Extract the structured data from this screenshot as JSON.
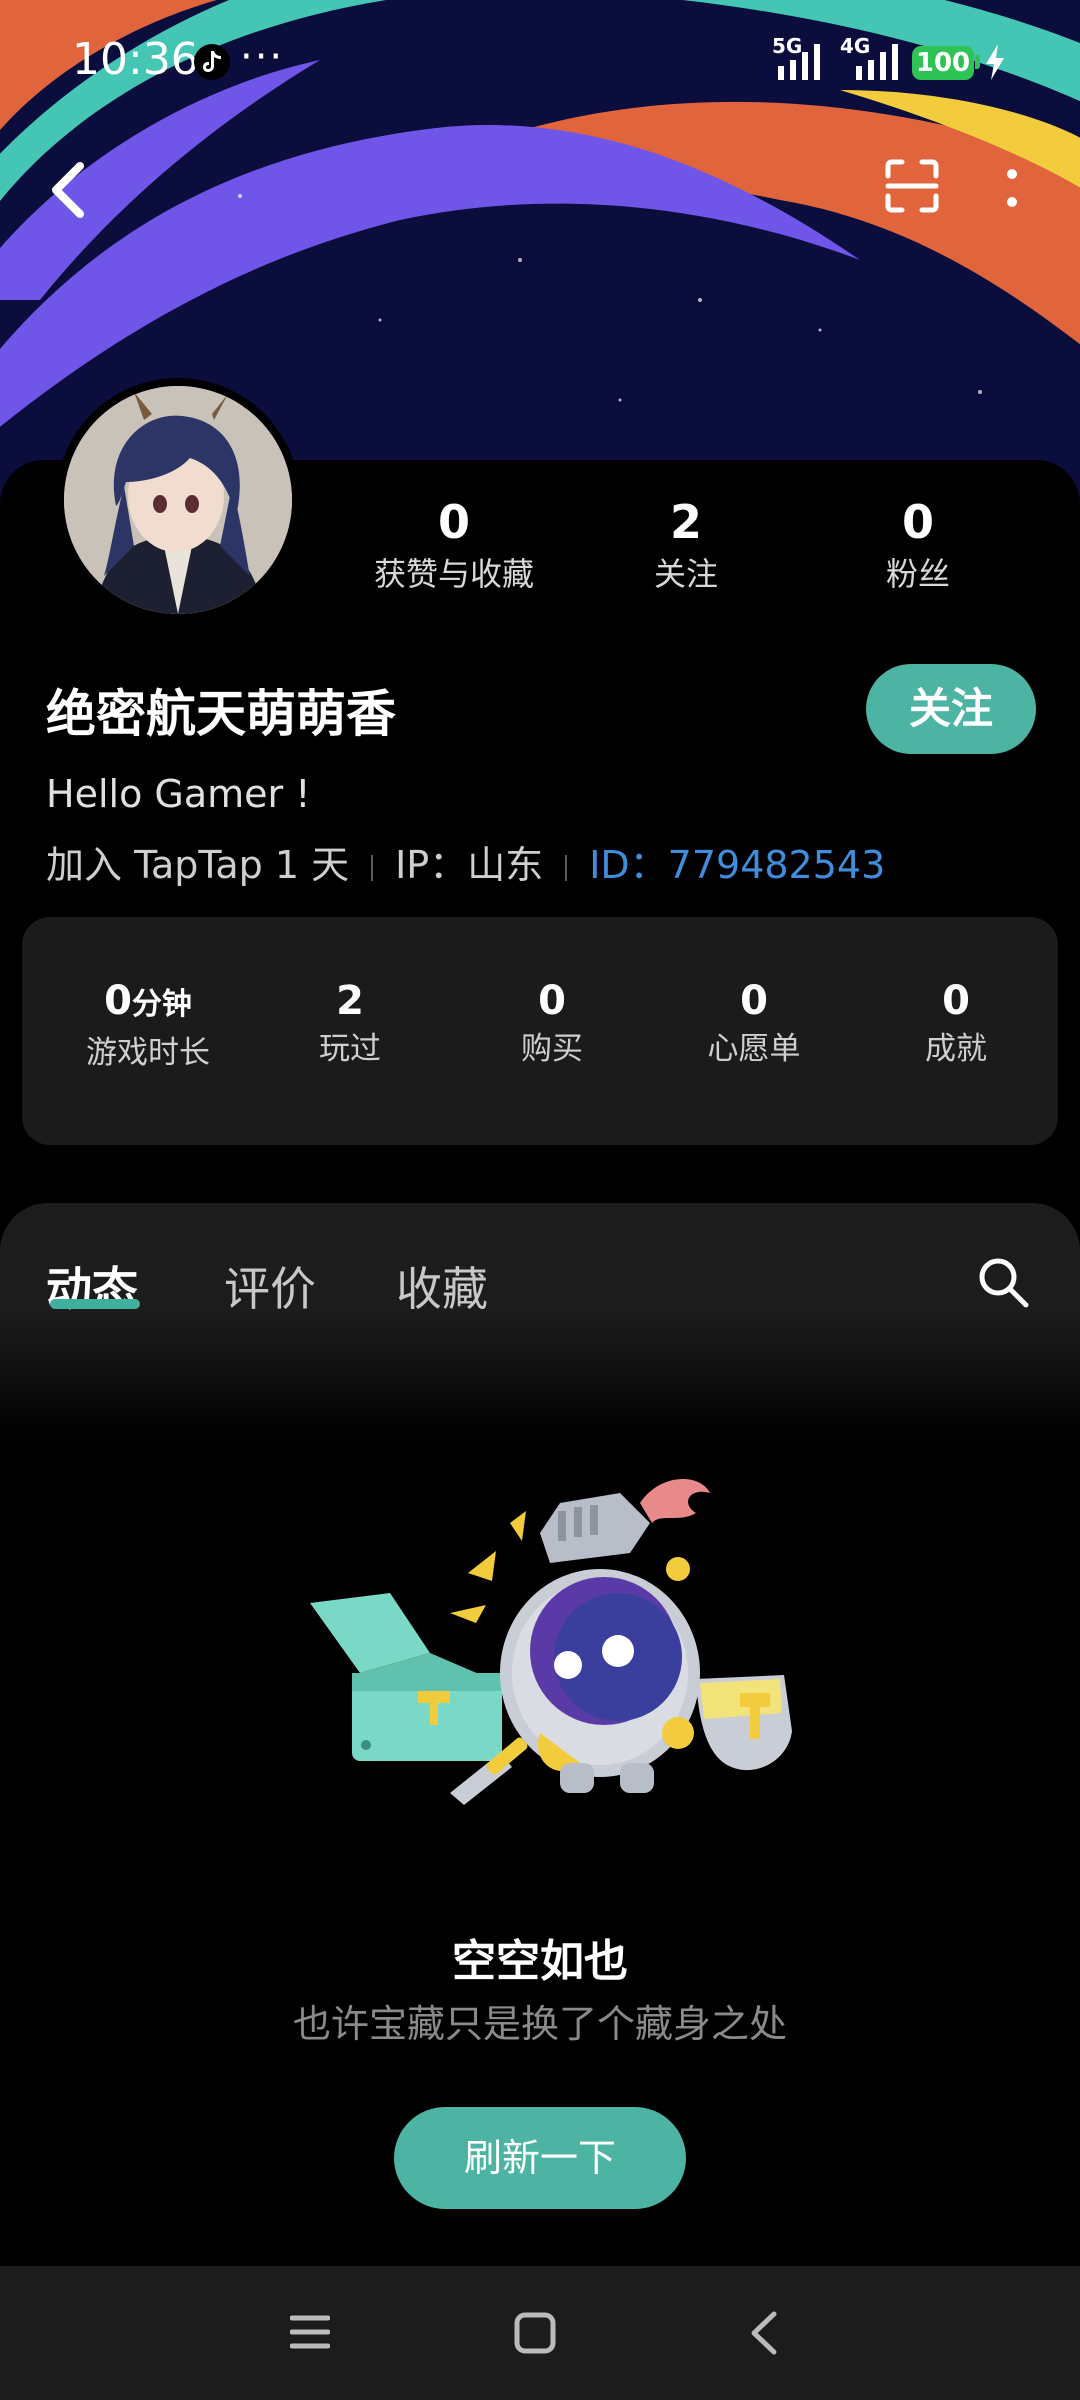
{
  "status_bar": {
    "time": "10:36",
    "more": "···",
    "net_5g": "5G",
    "net_4g": "4G",
    "battery": "100"
  },
  "profile": {
    "username": "绝密航天萌萌香",
    "follow_label": "关注",
    "bio": "Hello Gamer !",
    "joined": "加入 TapTap 1 天",
    "ip": "IP：山东",
    "id": "ID：779482543",
    "stats": [
      {
        "value": "0",
        "label": "获赞与收藏"
      },
      {
        "value": "2",
        "label": "关注"
      },
      {
        "value": "0",
        "label": "粉丝"
      }
    ]
  },
  "game_stats": {
    "playtime_value": "0",
    "playtime_unit": "分钟",
    "playtime_label": "游戏时长",
    "items": [
      {
        "value": "2",
        "label": "玩过"
      },
      {
        "value": "0",
        "label": "购买"
      },
      {
        "value": "0",
        "label": "心愿单"
      },
      {
        "value": "0",
        "label": "成就"
      }
    ]
  },
  "tabs": [
    {
      "label": "动态",
      "active": true
    },
    {
      "label": "评价",
      "active": false
    },
    {
      "label": "收藏",
      "active": false
    }
  ],
  "empty_state": {
    "title": "空空如也",
    "subtitle": "也许宝藏只是换了个藏身之处",
    "refresh_label": "刷新一下"
  },
  "icons": {
    "back": "back-arrow-icon",
    "scan": "scan-icon",
    "menu": "more-vertical-icon",
    "search": "search-icon"
  },
  "colors": {
    "accent": "#4db3a2",
    "id_link": "#3f8ddb"
  }
}
